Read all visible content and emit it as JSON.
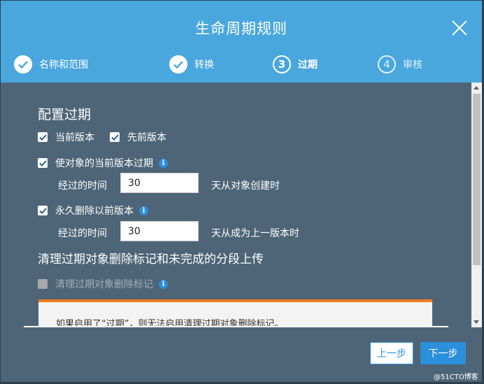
{
  "dialog": {
    "title": "生命周期规则"
  },
  "steps": [
    {
      "number": "",
      "label": "名称和范围",
      "state": "done"
    },
    {
      "number": "",
      "label": "转换",
      "state": "done"
    },
    {
      "number": "3",
      "label": "过期",
      "state": "current"
    },
    {
      "number": "4",
      "label": "审核",
      "state": "future"
    }
  ],
  "config": {
    "title": "配置过期",
    "current_version_label": "当前版本",
    "current_version_checked": true,
    "previous_version_label": "先前版本",
    "previous_version_checked": true,
    "expire_current": {
      "label": "使对象的当前版本过期",
      "checked": true,
      "elapsed_label": "经过的时间",
      "days_value": "30",
      "suffix": "天从对象创建时"
    },
    "delete_previous": {
      "label": "永久删除以前版本",
      "checked": true,
      "elapsed_label": "经过的时间",
      "days_value": "30",
      "suffix": "天从成为上一版本时"
    }
  },
  "cleanup": {
    "title": "清理过期对象删除标记和未完成的分段上传",
    "delete_markers_label": "清理过期对象删除标记",
    "delete_markers_checked": false,
    "delete_markers_disabled": true,
    "notice": "如果启用了“过期”，则无法启用清理过期对象删除标记。"
  },
  "footer": {
    "prev_label": "上一步",
    "next_label": "下一步"
  },
  "watermark": "@51CTO博客",
  "colors": {
    "header": "#49a7dd",
    "body": "#4d6577",
    "accent": "#2b8fd9",
    "notice_border": "#f27b1e"
  }
}
